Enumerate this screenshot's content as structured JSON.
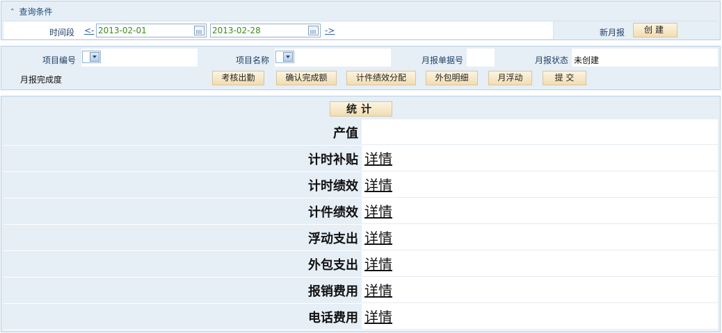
{
  "query_panel": {
    "title": "查询条件",
    "time_label": "时间段",
    "prev_link": "<-",
    "next_link": "->",
    "start_date": "2013-02-01",
    "end_date": "2013-02-28",
    "new_month_label": "新月报",
    "create_button": "创建"
  },
  "project_panel": {
    "project_no_label": "项目编号",
    "project_name_label": "项目名称",
    "report_no_label": "月报单据号",
    "report_status_label": "月报状态",
    "report_status_value": "未创建",
    "completion_label": "月报完成度",
    "buttons": [
      "考核出勤",
      "确认完成额",
      "计件绩效分配",
      "外包明细",
      "月浮动",
      "提 交"
    ]
  },
  "stats_panel": {
    "stats_button": "统计",
    "rows": [
      {
        "label": "产值",
        "value": ""
      },
      {
        "label": "计时补贴",
        "value": "详情"
      },
      {
        "label": "计时绩效",
        "value": "详情"
      },
      {
        "label": "计件绩效",
        "value": "详情"
      },
      {
        "label": "浮动支出",
        "value": "详情"
      },
      {
        "label": "外包支出",
        "value": "详情"
      },
      {
        "label": "报销费用",
        "value": "详情"
      },
      {
        "label": "电话费用",
        "value": "详情"
      }
    ]
  },
  "colors": {
    "panel_bg": "#e6eef6",
    "panel_border": "#b7cfe2",
    "link": "#2a5ea8",
    "date_text": "#3a8a17",
    "button_bg": "#f2ddb1"
  }
}
